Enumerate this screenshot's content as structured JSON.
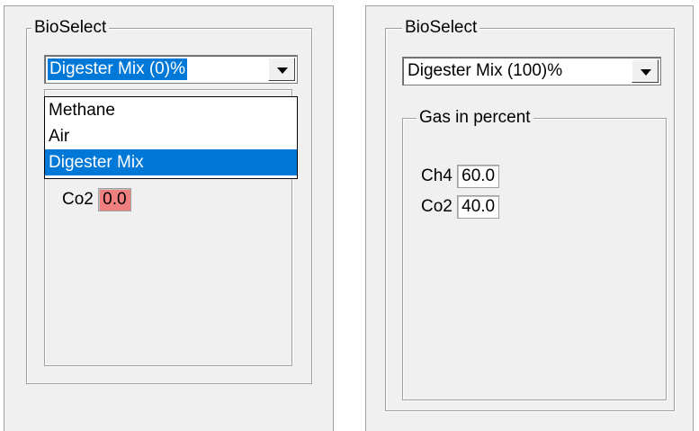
{
  "left": {
    "group_label": "BioSelect",
    "combo_value": "Digester Mix (0)%",
    "dropdown_items": [
      "Methane",
      "Air",
      "Digester Mix"
    ],
    "selected_index": 2,
    "co2_label": "Co2",
    "co2_value": "0.0"
  },
  "right": {
    "group_label": "BioSelect",
    "combo_value": "Digester Mix (100)%",
    "subgroup_label": "Gas in percent",
    "ch4_label": "Ch4",
    "ch4_value": "60.0",
    "co2_label": "Co2",
    "co2_value": "40.0"
  },
  "colors": {
    "selection": "#0078d7",
    "warning_value": "#f08080",
    "panel": "#f0f0f0"
  }
}
